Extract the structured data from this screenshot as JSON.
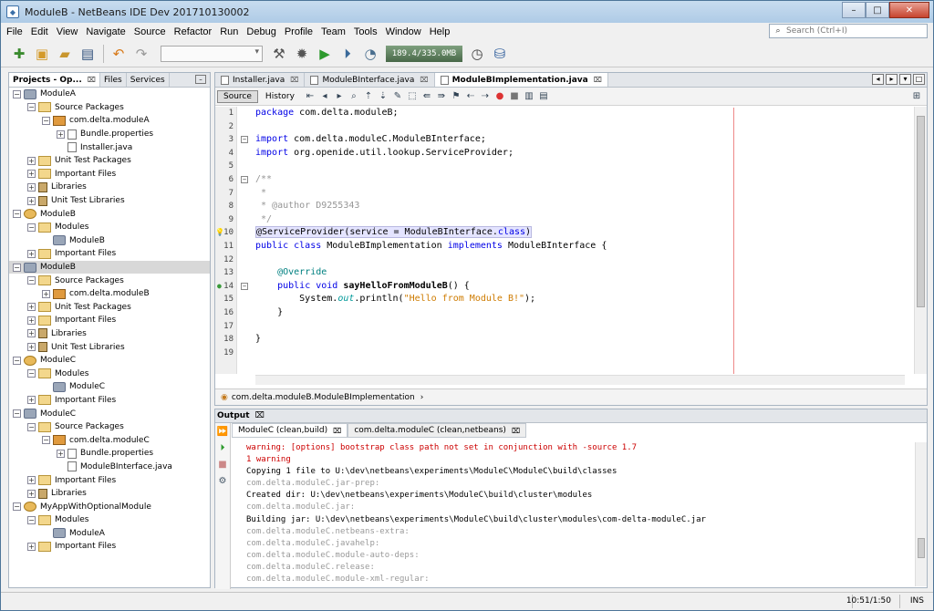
{
  "window": {
    "title": "ModuleB - NetBeans IDE Dev 201710130002",
    "min": "–",
    "max": "□",
    "close": "✕"
  },
  "menu": [
    "File",
    "Edit",
    "View",
    "Navigate",
    "Source",
    "Refactor",
    "Run",
    "Debug",
    "Profile",
    "Team",
    "Tools",
    "Window",
    "Help"
  ],
  "search": {
    "placeholder": "Search (Ctrl+I)"
  },
  "toolbar": {
    "memory": "189.4/335.0MB"
  },
  "projects": {
    "tabs": [
      {
        "label": "Projects - Op...",
        "close": "⌧"
      },
      {
        "label": "Files",
        "close": ""
      },
      {
        "label": "Services",
        "close": ""
      }
    ],
    "min": "–",
    "tree": [
      {
        "label": "ModuleA",
        "level": 0,
        "tog": "−",
        "icon": "module"
      },
      {
        "label": "Source Packages",
        "level": 1,
        "tog": "−",
        "icon": "folder"
      },
      {
        "label": "com.delta.moduleA",
        "level": 2,
        "tog": "−",
        "icon": "pkg"
      },
      {
        "label": "Bundle.properties",
        "level": 3,
        "tog": "+",
        "icon": "file"
      },
      {
        "label": "Installer.java",
        "level": 3,
        "tog": "",
        "icon": "file"
      },
      {
        "label": "Unit Test Packages",
        "level": 1,
        "tog": "+",
        "icon": "folder"
      },
      {
        "label": "Important Files",
        "level": 1,
        "tog": "+",
        "icon": "folder"
      },
      {
        "label": "Libraries",
        "level": 1,
        "tog": "+",
        "icon": "lib"
      },
      {
        "label": "Unit Test Libraries",
        "level": 1,
        "tog": "+",
        "icon": "lib"
      },
      {
        "label": "ModuleB",
        "level": 0,
        "tog": "−",
        "icon": "suite"
      },
      {
        "label": "Modules",
        "level": 1,
        "tog": "−",
        "icon": "folder"
      },
      {
        "label": "ModuleB",
        "level": 2,
        "tog": "",
        "icon": "module"
      },
      {
        "label": "Important Files",
        "level": 1,
        "tog": "+",
        "icon": "folder"
      },
      {
        "label": "ModuleB",
        "level": 0,
        "tog": "−",
        "icon": "module",
        "selected": true
      },
      {
        "label": "Source Packages",
        "level": 1,
        "tog": "−",
        "icon": "folder"
      },
      {
        "label": "com.delta.moduleB",
        "level": 2,
        "tog": "+",
        "icon": "pkg"
      },
      {
        "label": "Unit Test Packages",
        "level": 1,
        "tog": "+",
        "icon": "folder"
      },
      {
        "label": "Important Files",
        "level": 1,
        "tog": "+",
        "icon": "folder"
      },
      {
        "label": "Libraries",
        "level": 1,
        "tog": "+",
        "icon": "lib"
      },
      {
        "label": "Unit Test Libraries",
        "level": 1,
        "tog": "+",
        "icon": "lib"
      },
      {
        "label": "ModuleC",
        "level": 0,
        "tog": "−",
        "icon": "suite"
      },
      {
        "label": "Modules",
        "level": 1,
        "tog": "−",
        "icon": "folder"
      },
      {
        "label": "ModuleC",
        "level": 2,
        "tog": "",
        "icon": "module"
      },
      {
        "label": "Important Files",
        "level": 1,
        "tog": "+",
        "icon": "folder"
      },
      {
        "label": "ModuleC",
        "level": 0,
        "tog": "−",
        "icon": "module"
      },
      {
        "label": "Source Packages",
        "level": 1,
        "tog": "−",
        "icon": "folder"
      },
      {
        "label": "com.delta.moduleC",
        "level": 2,
        "tog": "−",
        "icon": "pkg"
      },
      {
        "label": "Bundle.properties",
        "level": 3,
        "tog": "+",
        "icon": "file"
      },
      {
        "label": "ModuleBInterface.java",
        "level": 3,
        "tog": "",
        "icon": "file"
      },
      {
        "label": "Important Files",
        "level": 1,
        "tog": "+",
        "icon": "folder"
      },
      {
        "label": "Libraries",
        "level": 1,
        "tog": "+",
        "icon": "lib"
      },
      {
        "label": "MyAppWithOptionalModule",
        "level": 0,
        "tog": "−",
        "icon": "suite"
      },
      {
        "label": "Modules",
        "level": 1,
        "tog": "−",
        "icon": "folder"
      },
      {
        "label": "ModuleA",
        "level": 2,
        "tog": "",
        "icon": "module"
      },
      {
        "label": "Important Files",
        "level": 1,
        "tog": "+",
        "icon": "folder"
      }
    ]
  },
  "editor": {
    "tabs": [
      {
        "label": "Installer.java",
        "close": "⌧",
        "active": false
      },
      {
        "label": "ModuleBInterface.java",
        "close": "⌧",
        "active": false
      },
      {
        "label": "ModuleBImplementation.java",
        "close": "⌧",
        "active": true
      }
    ],
    "nav": [
      "◂",
      "▸",
      "▾",
      "□"
    ],
    "source_label": "Source",
    "history_label": "History",
    "breadcrumb": "com.delta.moduleB.ModuleBImplementation",
    "lines": [
      {
        "n": "1",
        "fold": "",
        "html": "<span class=\"kw\">package</span> com.delta.moduleB;"
      },
      {
        "n": "2",
        "fold": "",
        "html": ""
      },
      {
        "n": "3",
        "fold": "−",
        "html": "<span class=\"kw\">import</span> com.delta.moduleC.ModuleBInterface;"
      },
      {
        "n": "4",
        "fold": "",
        "html": "<span class=\"kw\">import</span> org.openide.util.lookup.ServiceProvider;"
      },
      {
        "n": "5",
        "fold": "",
        "html": ""
      },
      {
        "n": "6",
        "fold": "−",
        "html": "<span class=\"cm\">/**</span>"
      },
      {
        "n": "7",
        "fold": "",
        "html": "<span class=\"cm\"> *</span>"
      },
      {
        "n": "8",
        "fold": "",
        "html": "<span class=\"cm\"> * @author D9255343</span>"
      },
      {
        "n": "9",
        "fold": "",
        "html": "<span class=\"cm\"> */</span>"
      },
      {
        "n": "10",
        "fold": "",
        "html": "<span class=\"hl\">@ServiceProvider(service = ModuleBInterface.<span class=\"kw\">class</span>)</span>"
      },
      {
        "n": "11",
        "fold": "",
        "html": "<span class=\"kw\">public class</span> ModuleBImplementation <span class=\"kw\">implements</span> ModuleBInterface {"
      },
      {
        "n": "12",
        "fold": "",
        "html": ""
      },
      {
        "n": "13",
        "fold": "",
        "html": "    <span class=\"an\">@Override</span>"
      },
      {
        "n": "14",
        "fold": "−",
        "html": "    <span class=\"kw\">public void</span> <span class=\"bold\">sayHelloFromModuleB</span>() {"
      },
      {
        "n": "15",
        "fold": "",
        "html": "        System.<span class=\"it\">out</span>.println(<span class=\"str\">\"Hello from Module B!\"</span>);"
      },
      {
        "n": "16",
        "fold": "",
        "html": "    }"
      },
      {
        "n": "17",
        "fold": "",
        "html": ""
      },
      {
        "n": "18",
        "fold": "",
        "html": "}"
      },
      {
        "n": "19",
        "fold": "",
        "html": ""
      }
    ]
  },
  "output": {
    "title": "Output",
    "close": "⌧",
    "tabs": [
      {
        "label": "ModuleC (clean,build)",
        "close": "⌧",
        "active": true
      },
      {
        "label": "com.delta.moduleC (clean,netbeans)",
        "close": "⌧",
        "active": false
      }
    ],
    "lines": [
      {
        "t": "warning: [options] bootstrap class path not set in conjunction with -source 1.7",
        "c": "err"
      },
      {
        "t": "1 warning",
        "c": "err"
      },
      {
        "t": "Copying 1 file to U:\\dev\\netbeans\\experiments\\ModuleC\\ModuleC\\build\\classes",
        "c": "norm"
      },
      {
        "t": "com.delta.moduleC.jar-prep:",
        "c": "dim"
      },
      {
        "t": "Created dir: U:\\dev\\netbeans\\experiments\\ModuleC\\build\\cluster\\modules",
        "c": "norm"
      },
      {
        "t": "com.delta.moduleC.jar:",
        "c": "dim"
      },
      {
        "t": "Building jar: U:\\dev\\netbeans\\experiments\\ModuleC\\build\\cluster\\modules\\com-delta-moduleC.jar",
        "c": "norm"
      },
      {
        "t": "com.delta.moduleC.netbeans-extra:",
        "c": "dim"
      },
      {
        "t": "com.delta.moduleC.javahelp:",
        "c": "dim"
      },
      {
        "t": "com.delta.moduleC.module-auto-deps:",
        "c": "dim"
      },
      {
        "t": "com.delta.moduleC.release:",
        "c": "dim"
      },
      {
        "t": "com.delta.moduleC.module-xml-regular:",
        "c": "dim"
      }
    ]
  },
  "status": {
    "position": "10:51/1:50",
    "mode": "INS"
  }
}
